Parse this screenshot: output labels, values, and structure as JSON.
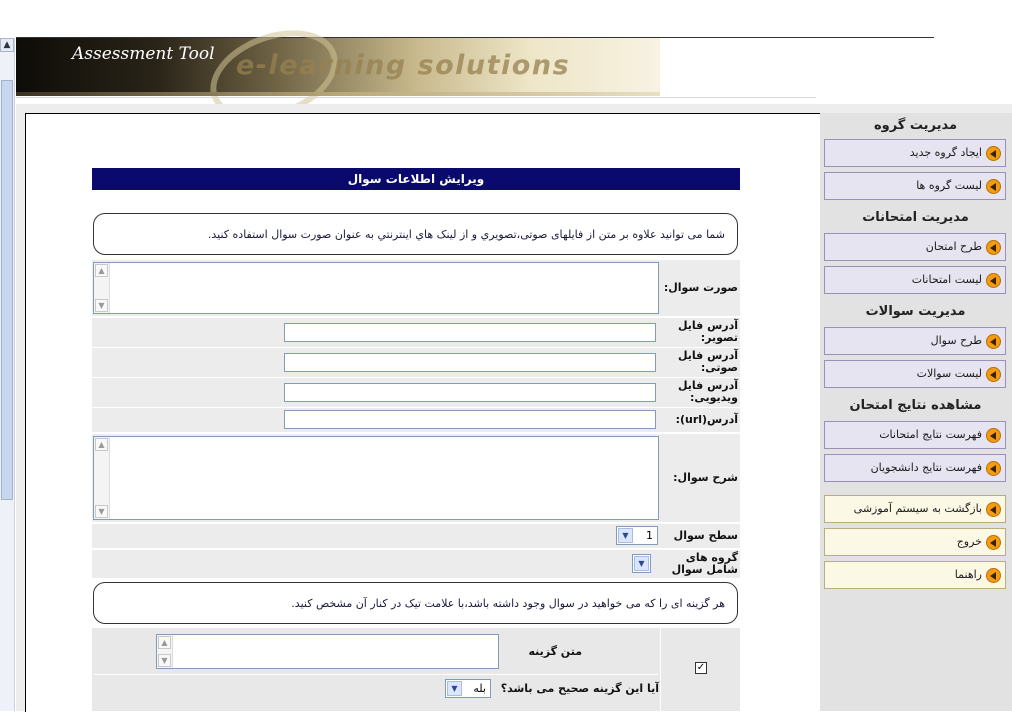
{
  "banner": {
    "title": "Assessment Tool",
    "slogan": "e-learning solutions"
  },
  "sidebar": {
    "sections": [
      {
        "title": "مدیریت گروه",
        "items": [
          "ایجاد گروه جدید",
          "لیست گروه ها"
        ]
      },
      {
        "title": "مدیریت امتحانات",
        "items": [
          "طرح امتحان",
          "لیست امتحانات"
        ]
      },
      {
        "title": "مدیریت سوالات",
        "items": [
          "طرح سوال",
          "لیست سوالات"
        ]
      },
      {
        "title": "مشاهده نتایج امتحان",
        "items": [
          "فهرست نتایج امتحانات",
          "فهرست نتایج دانشجویان"
        ]
      }
    ],
    "bottom_items": [
      "بازگشت به سیستم آموزشی",
      "خروج",
      "راهنما"
    ]
  },
  "form": {
    "header": "ویرایش اطلاعات سوال",
    "note1": "شما می توانید علاوه بر متن از فایلهای صوتی،تصویري و از لینک هاي اینترنتي به عنوان صورت سوال استفاده کنید.",
    "question_text_label": "صورت سوال:",
    "image_label": "آدرس فایل تصویر:",
    "audio_label": "آدرس فایل صوتی:",
    "video_label": "آدرس فایل ویدیویی:",
    "url_label": "آدرس(url):",
    "explanation_label": "شرح سوال:",
    "level_label": "سطح سوال",
    "level_value": "1",
    "groups_label": "گروه های شامل سوال",
    "note2": "هر گزینه ای را که می خواهید در سوال وجود داشته باشد،با علامت تیک در کنار آن مشخص کنید.",
    "option_text_label": "متن گزینه",
    "correct_label": "آیا این گزینه صحیح می باشد؟",
    "correct_value": "بله",
    "option_checked": "✓"
  }
}
